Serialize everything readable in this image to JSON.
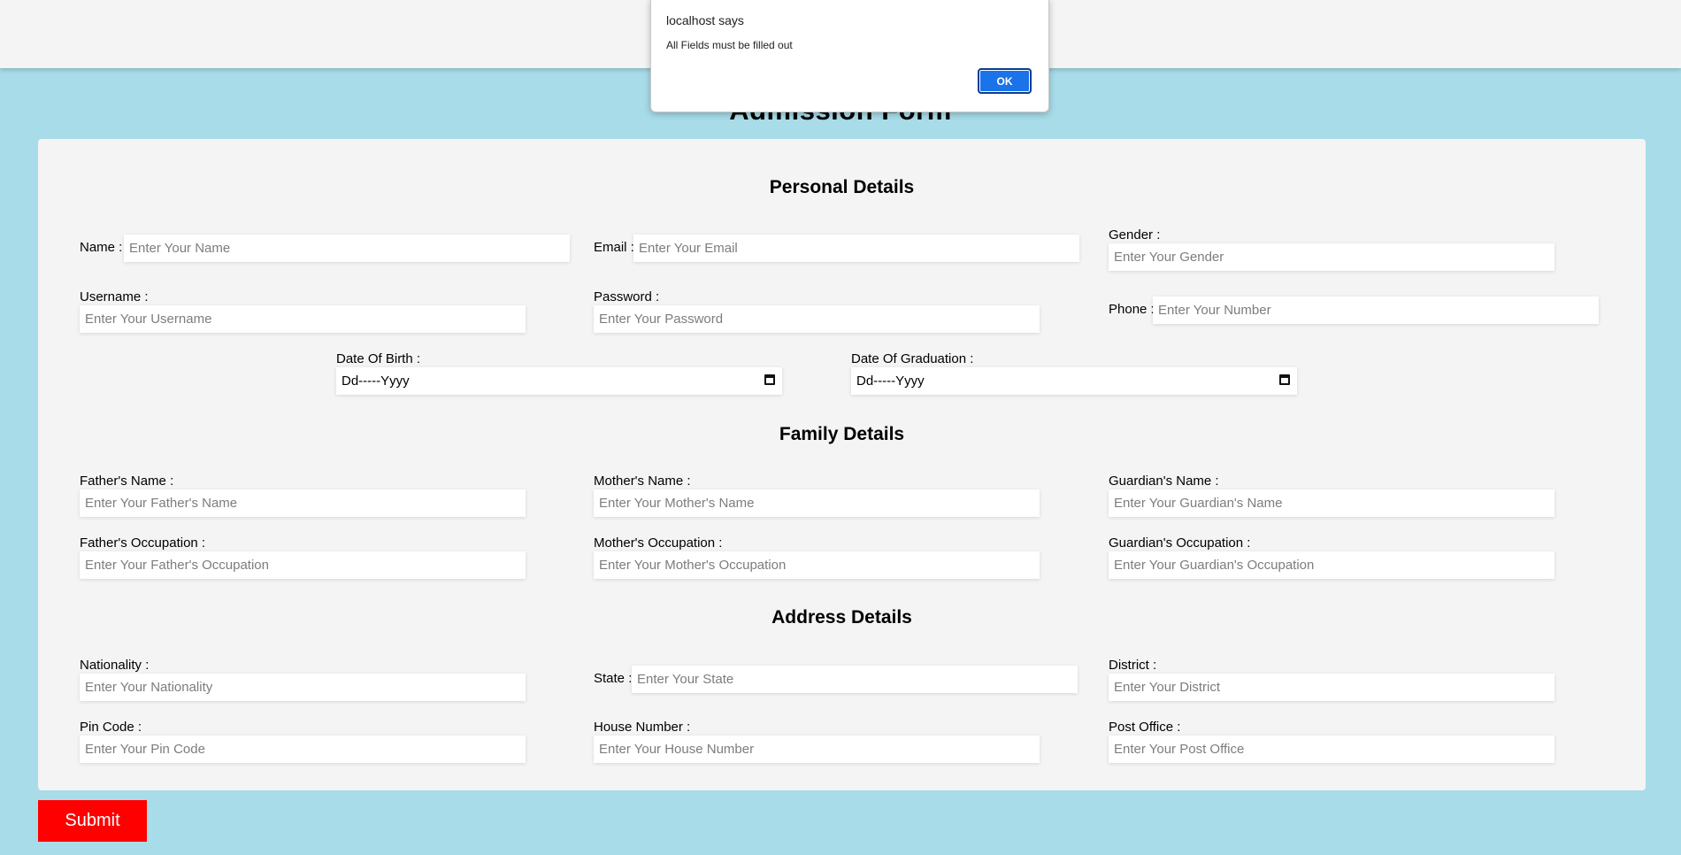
{
  "page": {
    "title": "Admission Form",
    "submit_label": "Submit"
  },
  "dialog": {
    "title": "localhost says",
    "message": "All Fields must be filled out",
    "ok_label": "OK"
  },
  "sections": {
    "personal": "Personal Details",
    "family": "Family Details",
    "address": "Address Details"
  },
  "fields": {
    "name": {
      "label": "Name :",
      "placeholder": "Enter Your Name"
    },
    "email": {
      "label": "Email :",
      "placeholder": "Enter Your Email"
    },
    "gender": {
      "label": "Gender :",
      "placeholder": "Enter Your Gender"
    },
    "username": {
      "label": "Username :",
      "placeholder": "Enter Your Username"
    },
    "password": {
      "label": "Password :",
      "placeholder": "Enter Your Password"
    },
    "phone": {
      "label": "Phone :",
      "placeholder": "Enter Your Number"
    },
    "dob": {
      "label": "Date Of Birth :",
      "value": "Dd-----Yyyy"
    },
    "dog": {
      "label": "Date Of Graduation :",
      "value": "Dd-----Yyyy"
    },
    "father_name": {
      "label": "Father's Name :",
      "placeholder": "Enter Your Father's Name"
    },
    "mother_name": {
      "label": "Mother's Name :",
      "placeholder": "Enter Your Mother's Name"
    },
    "guardian_name": {
      "label": "Guardian's Name :",
      "placeholder": "Enter Your Guardian's Name"
    },
    "father_occupation": {
      "label": "Father's Occupation :",
      "placeholder": "Enter Your Father's Occupation"
    },
    "mother_occupation": {
      "label": "Mother's Occupation :",
      "placeholder": "Enter Your Mother's Occupation"
    },
    "guardian_occupation": {
      "label": "Guardian's Occupation :",
      "placeholder": "Enter Your Guardian's Occupation"
    },
    "nationality": {
      "label": "Nationality :",
      "placeholder": "Enter Your Nationality"
    },
    "state": {
      "label": "State :",
      "placeholder": "Enter Your State"
    },
    "district": {
      "label": "District :",
      "placeholder": "Enter Your District"
    },
    "pin_code": {
      "label": "Pin Code :",
      "placeholder": "Enter Your Pin Code"
    },
    "house_number": {
      "label": "House Number :",
      "placeholder": "Enter Your House Number"
    },
    "post_office": {
      "label": "Post Office :",
      "placeholder": "Enter Your Post Office"
    }
  }
}
